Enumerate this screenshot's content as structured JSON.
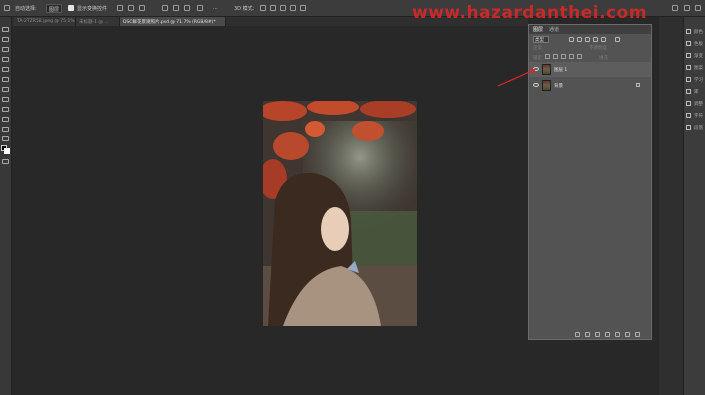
{
  "options_bar": {
    "auto_select_label": "自动选择:",
    "auto_select_value": "图层",
    "show_transform_label": "显示变换控件",
    "more_label": "..."
  },
  "document_tabs": [
    {
      "label": "TA-2TZR5B.jpeg @ 75.1% (RGB/8...",
      "active": false
    },
    {
      "label": "未标题-1 @ ...",
      "active": false
    },
    {
      "label": "DSC鲜花景观照片.psd @ 71.7% (RGB/8#)*",
      "active": true
    }
  ],
  "watermark": "www.hazardanthei.com",
  "layers_panel": {
    "tabs": [
      "图层",
      "通道"
    ],
    "kind_label": "类型",
    "opacity_label": "不透明度",
    "fill_label": "填充",
    "lock_label": "锁定",
    "layers": [
      {
        "name": "图层 1",
        "visible": true,
        "selected": true,
        "locked": false
      },
      {
        "name": "背景",
        "visible": true,
        "selected": false,
        "locked": true
      }
    ]
  },
  "right_dock": {
    "items": [
      {
        "label": "颜色",
        "icon": "color-icon"
      },
      {
        "label": "色板",
        "icon": "swatches-icon"
      },
      {
        "label": "渐变",
        "icon": "gradient-icon"
      },
      {
        "label": "图案",
        "icon": "pattern-icon"
      },
      {
        "label": "学习",
        "icon": "learn-icon"
      },
      {
        "label": "库",
        "icon": "libraries-icon"
      },
      {
        "label": "调整",
        "icon": "adjustments-icon"
      },
      {
        "label": "字符",
        "icon": "character-icon"
      },
      {
        "label": "段落",
        "icon": "paragraph-icon"
      }
    ]
  },
  "colors": {
    "accent_annotation": "#e02626",
    "workspace": "#282828",
    "panel": "#535353"
  }
}
